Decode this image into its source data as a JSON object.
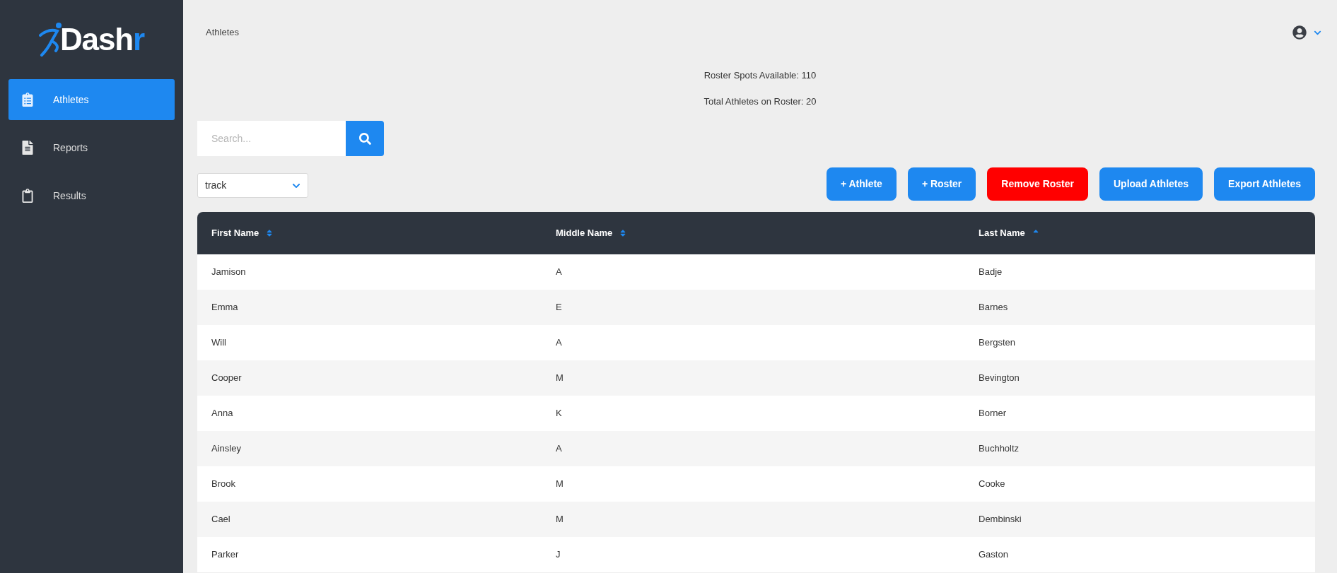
{
  "sidebar": {
    "logo": {
      "main": "Dash",
      "accent": "r"
    },
    "items": [
      {
        "label": "Athletes",
        "kind": "list",
        "selected": true
      },
      {
        "label": "Reports",
        "kind": "document",
        "selected": false
      },
      {
        "label": "Results",
        "kind": "board",
        "selected": false
      }
    ]
  },
  "breadcrumb": "Athletes",
  "stats": [
    "Roster Spots Available: 110",
    "Total Athletes on Roster: 20"
  ],
  "search": {
    "placeholder": "Search..."
  },
  "roster_select": {
    "value": "track"
  },
  "buttons": [
    {
      "label": "+ Athlete",
      "kind": "primary"
    },
    {
      "label": "+ Roster",
      "kind": "primary"
    },
    {
      "label": "Remove Roster",
      "kind": "danger"
    },
    {
      "label": "Upload Athletes",
      "kind": "primary"
    },
    {
      "label": "Export Athletes",
      "kind": "primary"
    }
  ],
  "table": {
    "columns": [
      {
        "label": "First Name",
        "kind": "unsorted"
      },
      {
        "label": "Middle Name",
        "kind": "unsorted"
      },
      {
        "label": "Last Name",
        "kind": "ascending"
      }
    ],
    "rows": [
      [
        "Jamison",
        "A",
        "Badje"
      ],
      [
        "Emma",
        "E",
        "Barnes"
      ],
      [
        "Will",
        "A",
        "Bergsten"
      ],
      [
        "Cooper",
        "M",
        "Bevington"
      ],
      [
        "Anna",
        "K",
        "Borner"
      ],
      [
        "Ainsley",
        "A",
        "Buchholtz"
      ],
      [
        "Brook",
        "M",
        "Cooke"
      ],
      [
        "Cael",
        "M",
        "Dembinski"
      ],
      [
        "Parker",
        "J",
        "Gaston"
      ]
    ]
  }
}
